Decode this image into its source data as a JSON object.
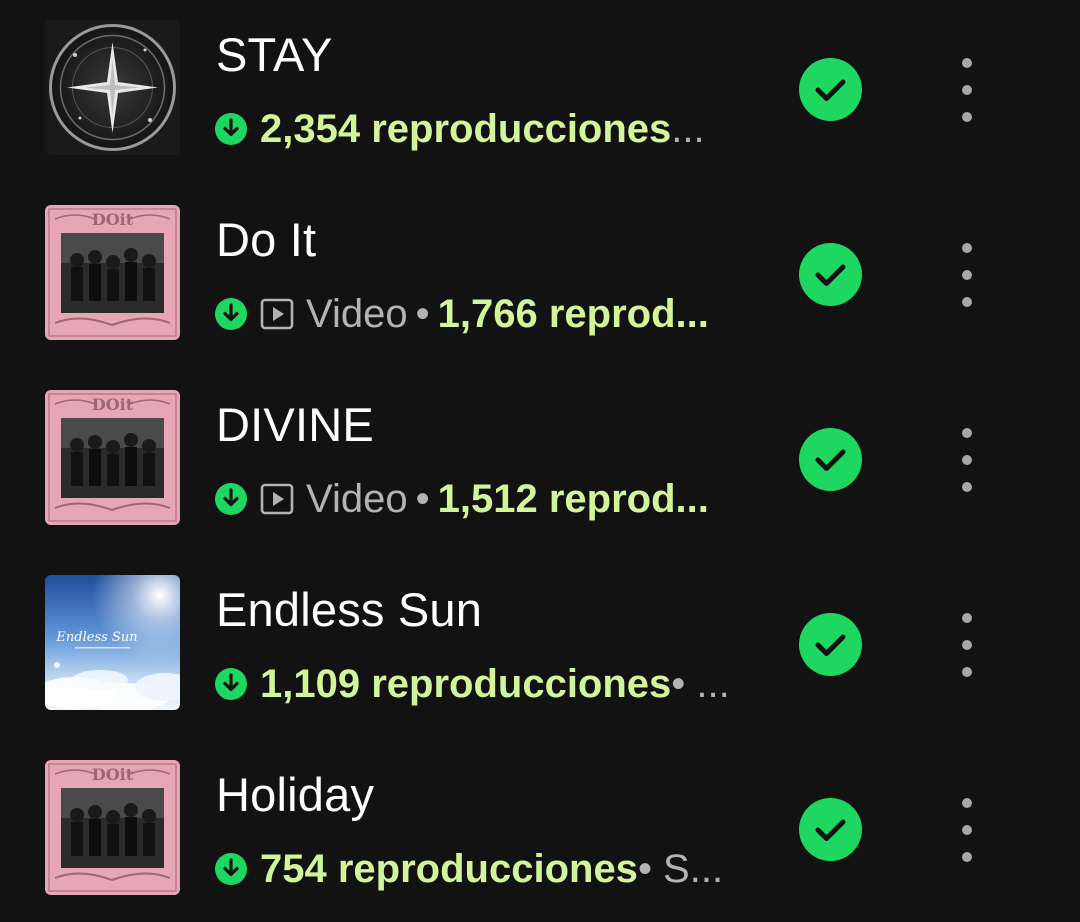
{
  "colors": {
    "background": "#121212",
    "title": "#ffffff",
    "plays": "#d2f59a",
    "secondary": "#b3b3b3",
    "accent_green": "#1ed760"
  },
  "tracks": [
    {
      "title": "STAY",
      "has_video": false,
      "video_label": "",
      "plays": "2,354 reproducciones",
      "tail": " ...",
      "cover": "stay-compass-cover",
      "downloaded": true,
      "added": true
    },
    {
      "title": "Do It",
      "has_video": true,
      "video_label": "Video",
      "plays": "1,766 reprod...",
      "tail": "",
      "cover": "pink-group-photo-cover",
      "downloaded": true,
      "added": true
    },
    {
      "title": "DIVINE",
      "has_video": true,
      "video_label": "Video",
      "plays": "1,512 reprod...",
      "tail": "",
      "cover": "pink-group-photo-cover",
      "downloaded": true,
      "added": true
    },
    {
      "title": "Endless Sun",
      "has_video": false,
      "video_label": "",
      "plays": "1,109 reproducciones",
      "tail": " • ...",
      "cover": "endless-sun-sky-cover",
      "downloaded": true,
      "added": true
    },
    {
      "title": "Holiday",
      "has_video": false,
      "video_label": "",
      "plays": "754 reproducciones",
      "tail": " • S...",
      "cover": "pink-group-photo-cover",
      "downloaded": true,
      "added": true
    }
  ],
  "cover_text": {
    "pink_logo": "DOit",
    "endless_sun": "Endless Sun"
  }
}
